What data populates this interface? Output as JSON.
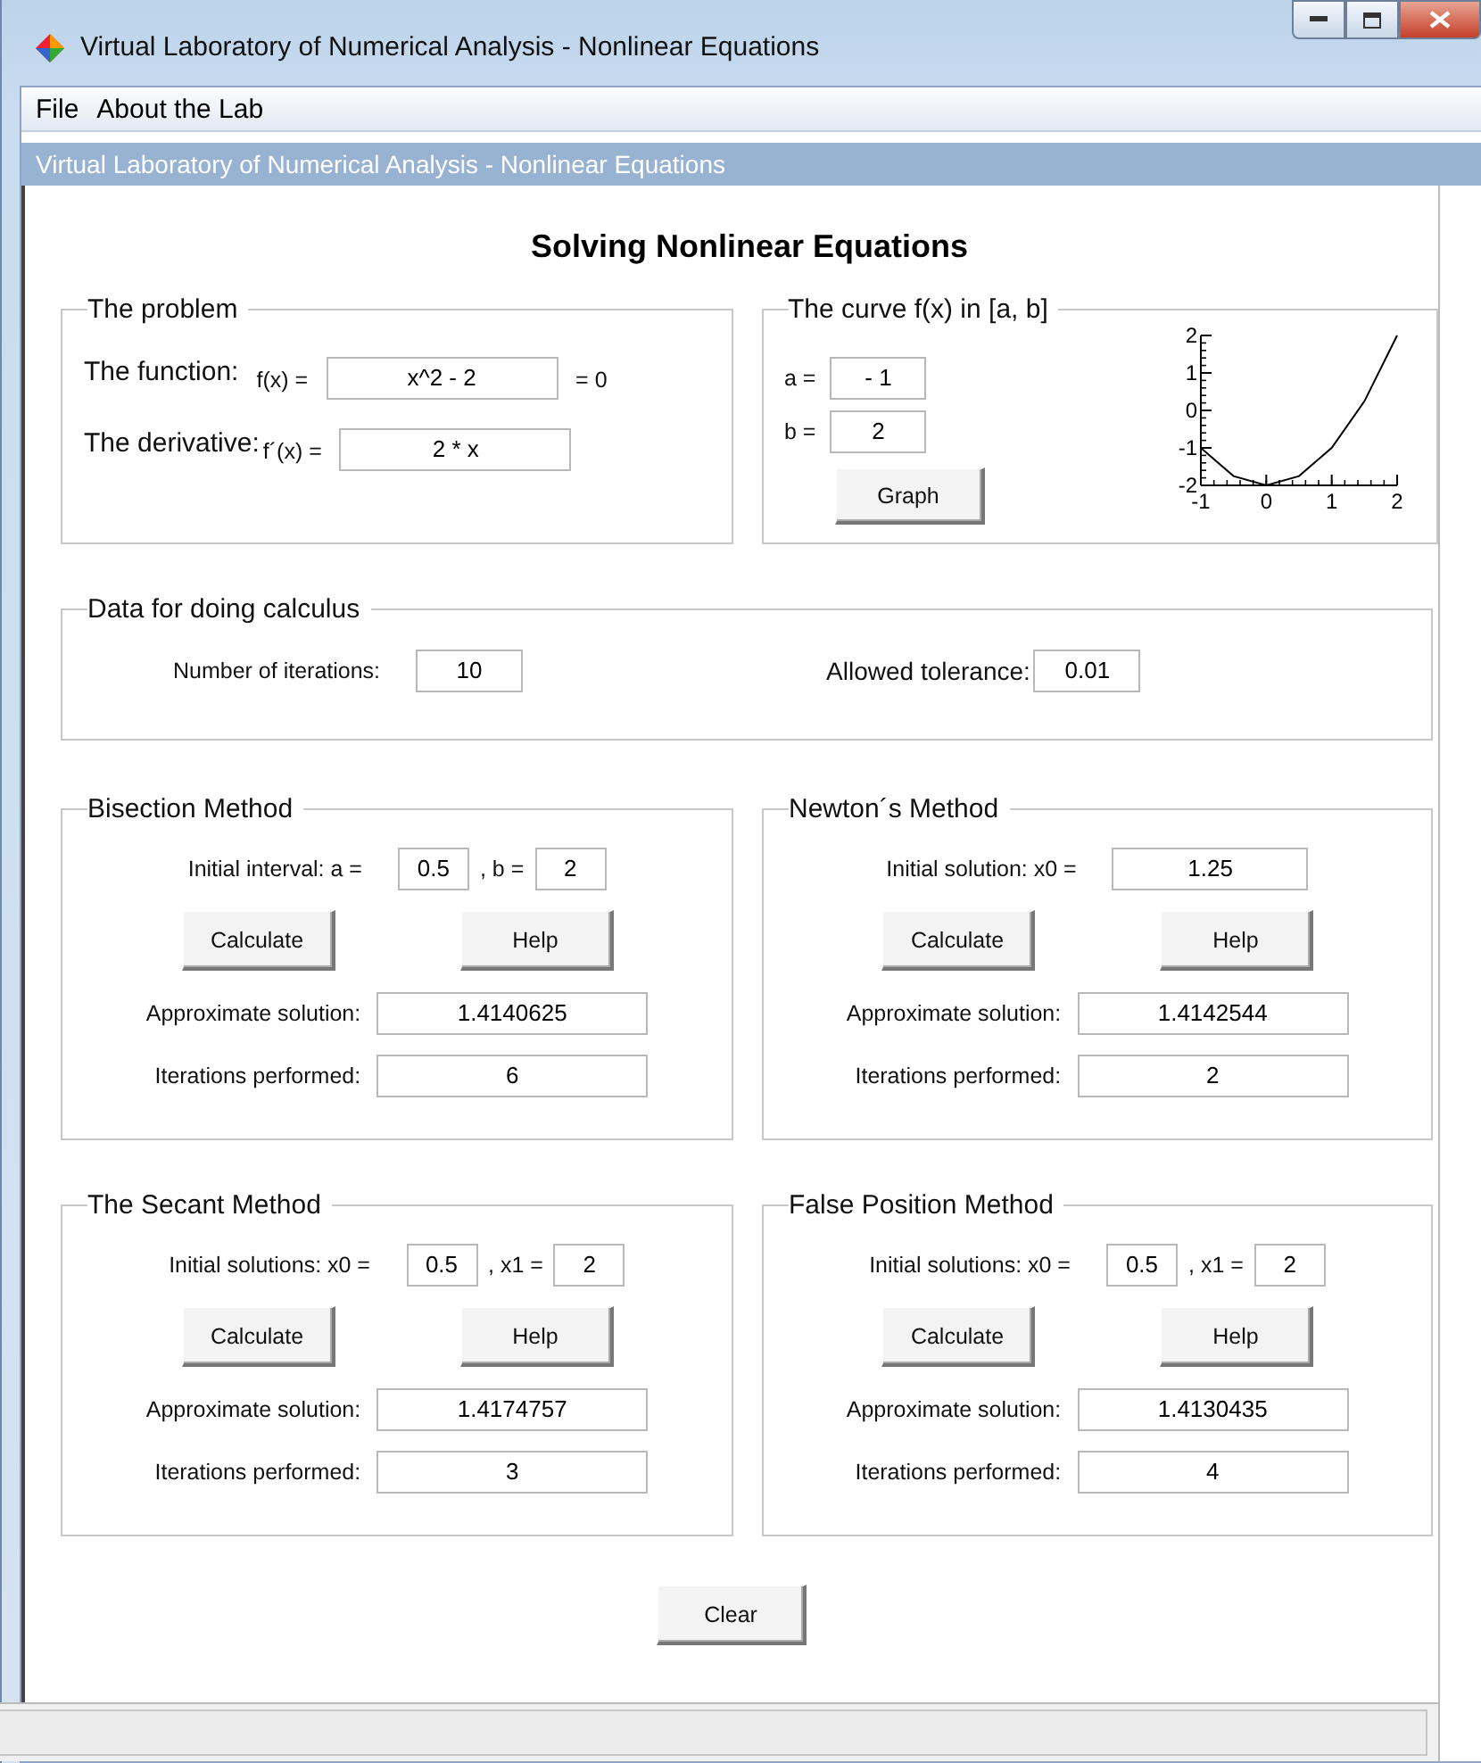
{
  "window": {
    "title": "Virtual Laboratory of Numerical Analysis - Nonlinear Equations"
  },
  "menu": [
    {
      "label": "File"
    },
    {
      "label": "About the Lab"
    }
  ],
  "banner": "Virtual Laboratory of Numerical Analysis - Nonlinear Equations",
  "heading": "Solving Nonlinear Equations",
  "problem": {
    "title": "The problem",
    "function_label": "The function:",
    "fx_label": "f(x) =",
    "function_value": "x^2 - 2",
    "equals_zero": "= 0",
    "derivative_label": "The derivative:",
    "dfx_label": "f´(x) =",
    "derivative_value": "2 * x"
  },
  "curve": {
    "title": "The curve f(x) in [a, b]",
    "a_label": "a =",
    "a_value": "- 1",
    "b_label": "b =",
    "b_value": "2",
    "button": "Graph",
    "chart_data": {
      "type": "line",
      "x": [
        -1,
        -0.5,
        0,
        0.5,
        1,
        1.5,
        2
      ],
      "series": [
        {
          "color": "#000000",
          "values": [
            -1,
            -1.75,
            -2,
            -1.75,
            -1,
            0.25,
            2
          ]
        }
      ],
      "xlim": [
        -1,
        2
      ],
      "ylim": [
        -2,
        2
      ],
      "xticks": [
        -1,
        0,
        1,
        2
      ],
      "yticks": [
        -2,
        -1,
        0,
        1,
        2
      ]
    }
  },
  "data": {
    "title": "Data for doing calculus",
    "iterations_label": "Number of iterations:",
    "iterations_value": "10",
    "tolerance_label": "Allowed tolerance:",
    "tolerance_value": "0.01"
  },
  "methods": [
    {
      "title": "Bisection Method",
      "inputs": [
        {
          "label": "Initial interval: a =",
          "value": "0.5"
        },
        {
          "label": ", b =",
          "value": "2"
        }
      ],
      "calculate": "Calculate",
      "help": "Help",
      "solution_label": "Approximate solution:",
      "solution": "1.4140625",
      "iterations_label": "Iterations performed:",
      "iterations": "6"
    },
    {
      "title": "Newton´s Method",
      "inputs": [
        {
          "label": "Initial solution: x0 =",
          "value": "1.25"
        }
      ],
      "calculate": "Calculate",
      "help": "Help",
      "solution_label": "Approximate solution:",
      "solution": "1.4142544",
      "iterations_label": "Iterations performed:",
      "iterations": "2"
    },
    {
      "title": "The Secant Method",
      "inputs": [
        {
          "label": "Initial solutions: x0 =",
          "value": "0.5"
        },
        {
          "label": ", x1 =",
          "value": "2"
        }
      ],
      "calculate": "Calculate",
      "help": "Help",
      "solution_label": "Approximate solution:",
      "solution": "1.4174757",
      "iterations_label": "Iterations performed:",
      "iterations": "3"
    },
    {
      "title": "False Position Method",
      "inputs": [
        {
          "label": "Initial solutions: x0 =",
          "value": "0.5"
        },
        {
          "label": ", x1 =",
          "value": "2"
        }
      ],
      "calculate": "Calculate",
      "help": "Help",
      "solution_label": "Approximate solution:",
      "solution": "1.4130435",
      "iterations_label": "Iterations performed:",
      "iterations": "4"
    }
  ],
  "clear_button": "Clear"
}
